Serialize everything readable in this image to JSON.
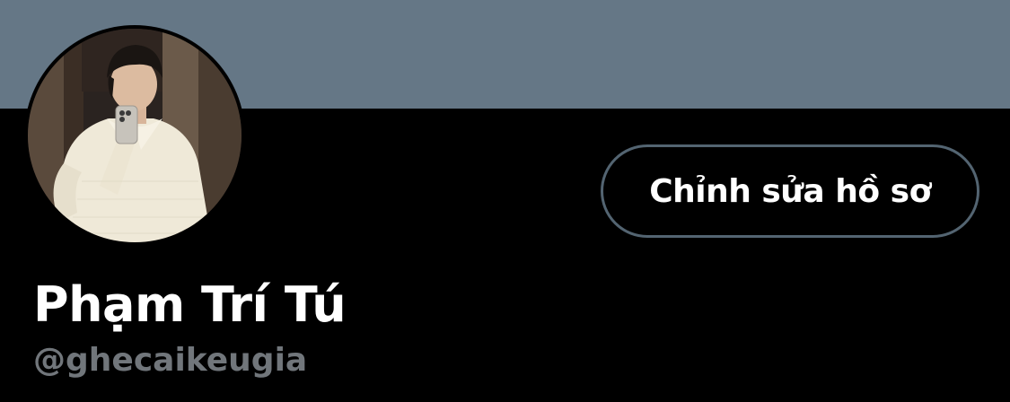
{
  "colors": {
    "banner": "#657786",
    "background": "#000000",
    "button_border": "#536471",
    "handle_text": "#71767b",
    "primary_text": "#ffffff"
  },
  "profile": {
    "display_name": "Phạm Trí Tú",
    "handle": "@ghecaikeugia",
    "edit_profile_label": "Chỉnh sửa hồ sơ",
    "avatar_icon": "profile-photo"
  }
}
